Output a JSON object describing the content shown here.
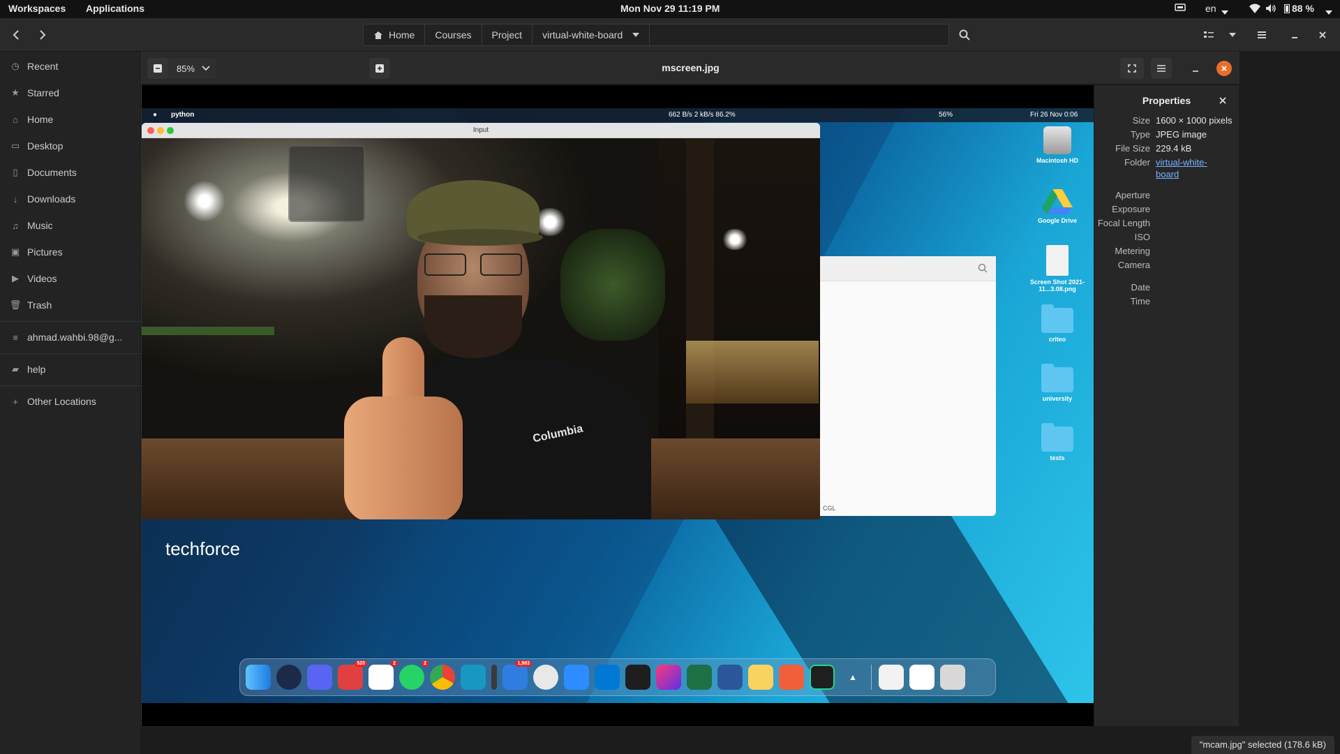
{
  "top_panel": {
    "workspaces": "Workspaces",
    "applications": "Applications",
    "clock": "Mon Nov 29  11:19 PM",
    "language": "en",
    "battery": "88 %"
  },
  "header": {
    "crumbs": [
      "Home",
      "Courses",
      "Project",
      "virtual-white-board"
    ]
  },
  "sidebar": {
    "items": [
      {
        "label": "Recent",
        "icon": "clock-icon"
      },
      {
        "label": "Starred",
        "icon": "star-icon"
      },
      {
        "label": "Home",
        "icon": "home-icon"
      },
      {
        "label": "Desktop",
        "icon": "desktop-icon"
      },
      {
        "label": "Documents",
        "icon": "document-icon"
      },
      {
        "label": "Downloads",
        "icon": "download-icon"
      },
      {
        "label": "Music",
        "icon": "music-icon"
      },
      {
        "label": "Pictures",
        "icon": "picture-icon"
      },
      {
        "label": "Videos",
        "icon": "video-icon"
      },
      {
        "label": "Trash",
        "icon": "trash-icon"
      },
      {
        "label": "ahmad.wahbi.98@g...",
        "icon": "network-drive-icon"
      },
      {
        "label": "help",
        "icon": "folder-icon"
      },
      {
        "label": "Other Locations",
        "icon": "plus-icon"
      }
    ]
  },
  "viewer": {
    "zoom": "85%",
    "title": "mscreen.jpg"
  },
  "screenshot": {
    "mac_app": "python",
    "mac_stats": "662 B/s 2 kB/s  86.2%",
    "mac_battery": "56%",
    "mac_clock": "Fri 26 Nov  0:06",
    "input_title": "Input",
    "finder_path": "CGL",
    "brand_prefix": "tech",
    "brand_suffix": "force",
    "jacket_logo": "Columbia",
    "desktop_icons": [
      "Macintosh HD",
      "Google Drive",
      "Screen Shot 2021-11...3.08.png",
      "criteo",
      "university",
      "tests"
    ],
    "dock_badges": {
      "mail": "520",
      "slack": "2",
      "whatsapp": "2",
      "airmail": "1,983"
    }
  },
  "properties": {
    "title": "Properties",
    "rows": [
      {
        "label": "Size",
        "value": "1600 × 1000 pixels"
      },
      {
        "label": "Type",
        "value": "JPEG image"
      },
      {
        "label": "File Size",
        "value": "229.4 kB"
      },
      {
        "label": "Folder",
        "value": "virtual-white-",
        "value2": "board"
      },
      {
        "label": "Aperture",
        "value": ""
      },
      {
        "label": "Exposure",
        "value": ""
      },
      {
        "label": "Focal Length",
        "value": ""
      },
      {
        "label": "ISO",
        "value": ""
      },
      {
        "label": "Metering",
        "value": ""
      },
      {
        "label": "Camera",
        "value": ""
      },
      {
        "label": "Date",
        "value": ""
      },
      {
        "label": "Time",
        "value": ""
      }
    ]
  },
  "status": "\"mcam.jpg\" selected  (178.6 kB)"
}
